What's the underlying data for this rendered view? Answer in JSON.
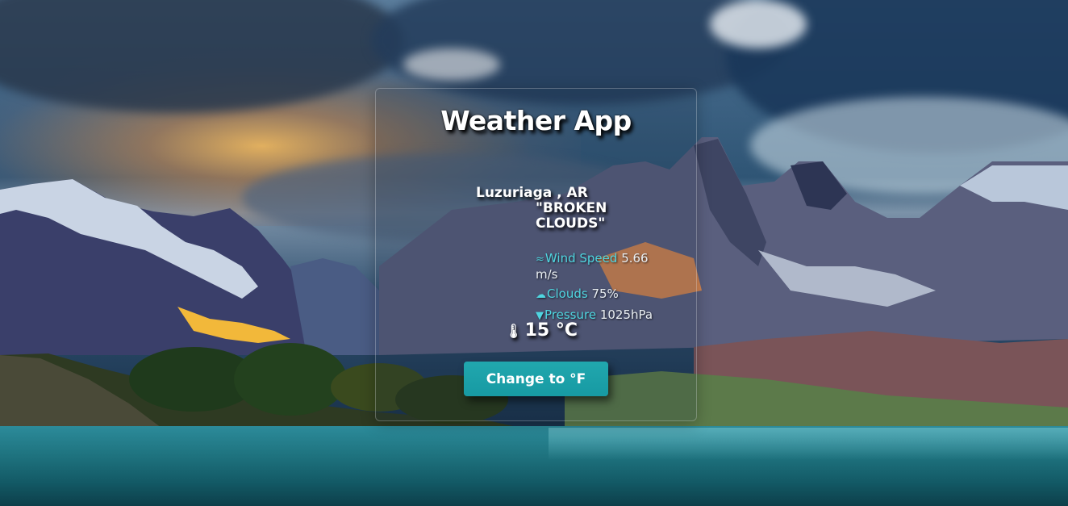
{
  "app": {
    "title": "Weather App"
  },
  "location": {
    "city_country": "Luzuriaga , AR",
    "description_line1": "\"BROKEN",
    "description_line2": "CLOUDS\""
  },
  "stats": {
    "wind": {
      "icon": "wind-icon",
      "label": "Wind Speed",
      "value": "5.66 m/s"
    },
    "clouds": {
      "icon": "cloud-icon",
      "label": "Clouds",
      "value": "75%"
    },
    "pressure": {
      "icon": "pressure-down-icon",
      "label": "Pressure",
      "value": "1025hPa"
    }
  },
  "temperature": {
    "icon": "thermometer-icon",
    "value": "15 °C"
  },
  "button": {
    "label": "Change to °F"
  },
  "colors": {
    "accent": "#4fd5e0",
    "button": "#179aa3",
    "text": "#ffffff"
  }
}
